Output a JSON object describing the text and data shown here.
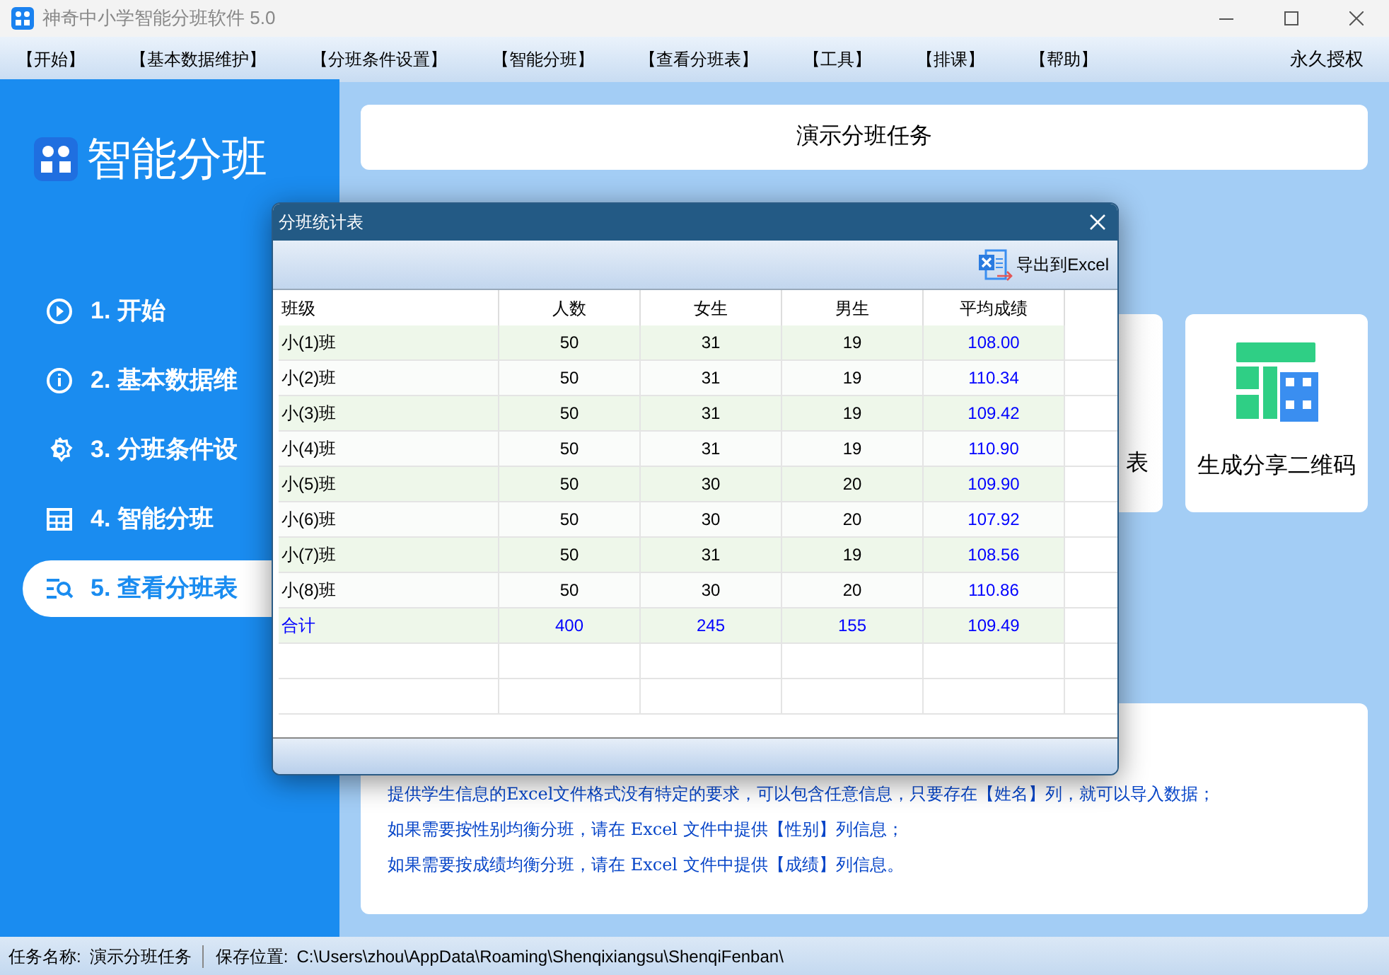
{
  "window": {
    "title": "神奇中小学智能分班软件 5.0"
  },
  "menu": [
    {
      "label": "【开始】"
    },
    {
      "label": "【基本数据维护】"
    },
    {
      "label": "【分班条件设置】"
    },
    {
      "label": "【智能分班】"
    },
    {
      "label": "【查看分班表】"
    },
    {
      "label": "【工具】"
    },
    {
      "label": "【排课】"
    },
    {
      "label": "【帮助】"
    }
  ],
  "license": "永久授权",
  "sidebar": {
    "title": "智能分班",
    "items": [
      {
        "label": "1. 开始",
        "selected": false
      },
      {
        "label": "2. 基本数据维",
        "selected": false
      },
      {
        "label": "3. 分班条件设",
        "selected": false
      },
      {
        "label": "4. 智能分班",
        "selected": false
      },
      {
        "label": "5. 查看分班表",
        "selected": true
      }
    ]
  },
  "task_title": "演示分班任务",
  "cards": [
    {
      "label": "表"
    },
    {
      "label": "生成分享二维码"
    }
  ],
  "notes": [
    "提供学生信息的Excel文件格式没有特定的要求，可以包含任意信息，只要存在【姓名】列，就可以导入数据；",
    "如果需要按性别均衡分班，请在 Excel 文件中提供【性别】列信息；",
    "如果需要按成绩均衡分班，请在 Excel 文件中提供【成绩】列信息。"
  ],
  "dialog": {
    "title": "分班统计表",
    "export_button": "导出到Excel",
    "table": {
      "columns": [
        "班级",
        "人数",
        "女生",
        "男生",
        "平均成绩"
      ],
      "rows": [
        {
          "kind": "class",
          "cells": [
            "小(1)班",
            "50",
            "31",
            "19",
            "108.00"
          ]
        },
        {
          "kind": "class",
          "cells": [
            "小(2)班",
            "50",
            "31",
            "19",
            "110.34"
          ]
        },
        {
          "kind": "class",
          "cells": [
            "小(3)班",
            "50",
            "31",
            "19",
            "109.42"
          ]
        },
        {
          "kind": "class",
          "cells": [
            "小(4)班",
            "50",
            "31",
            "19",
            "110.90"
          ]
        },
        {
          "kind": "class",
          "cells": [
            "小(5)班",
            "50",
            "30",
            "20",
            "109.90"
          ]
        },
        {
          "kind": "class",
          "cells": [
            "小(6)班",
            "50",
            "30",
            "20",
            "107.92"
          ]
        },
        {
          "kind": "class",
          "cells": [
            "小(7)班",
            "50",
            "31",
            "19",
            "108.56"
          ]
        },
        {
          "kind": "class",
          "cells": [
            "小(8)班",
            "50",
            "30",
            "20",
            "110.86"
          ]
        },
        {
          "kind": "total",
          "cells": [
            "合计",
            "400",
            "245",
            "155",
            "109.49"
          ]
        }
      ]
    }
  },
  "status_bar": {
    "task_label": "任务名称:",
    "task": "演示分班任务",
    "path_label": "保存位置:",
    "path": "C:\\Users\\zhou\\AppData\\Roaming\\Shenqixiangsu\\ShenqiFenban\\"
  }
}
